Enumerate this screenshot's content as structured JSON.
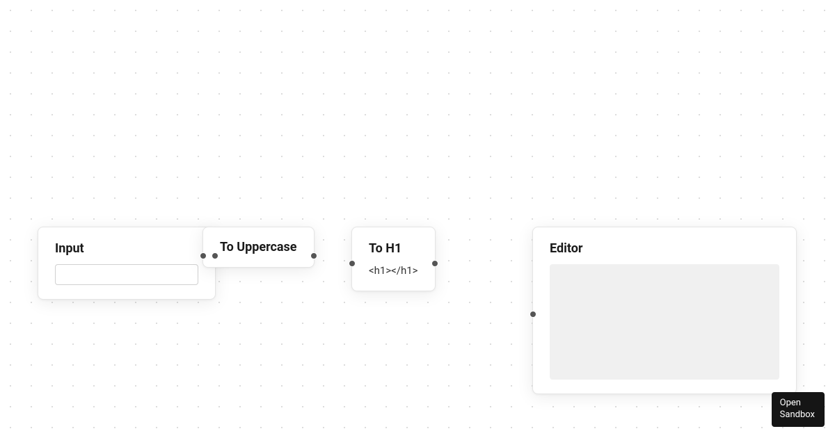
{
  "nodes": {
    "input": {
      "title": "Input",
      "value": ""
    },
    "uppercase": {
      "title": "To Uppercase"
    },
    "h1": {
      "title": "To H1",
      "content": "<h1></h1>"
    },
    "editor": {
      "title": "Editor"
    }
  },
  "sandbox": {
    "line1": "Open",
    "line2": "Sandbox"
  }
}
